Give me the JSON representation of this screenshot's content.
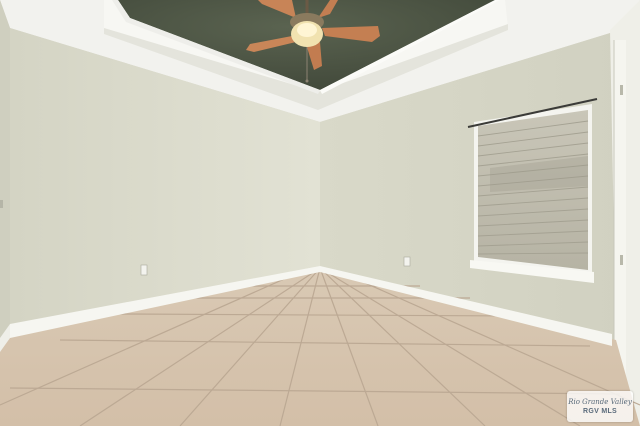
{
  "watermark": {
    "brand": "Rio Grande Valley",
    "sub": "RGV MLS"
  },
  "palette": {
    "left_wall": "#dcdccd",
    "right_wall": "#d6d6c6",
    "ceiling": "#f3f3ef",
    "tray_recess": "#48503f",
    "floor": "#d7c4ae",
    "grout": "#b9a893",
    "baseboard": "#f5f5f0",
    "window_glass": "#bdbdb0",
    "fan_blade": "#c9845a"
  }
}
